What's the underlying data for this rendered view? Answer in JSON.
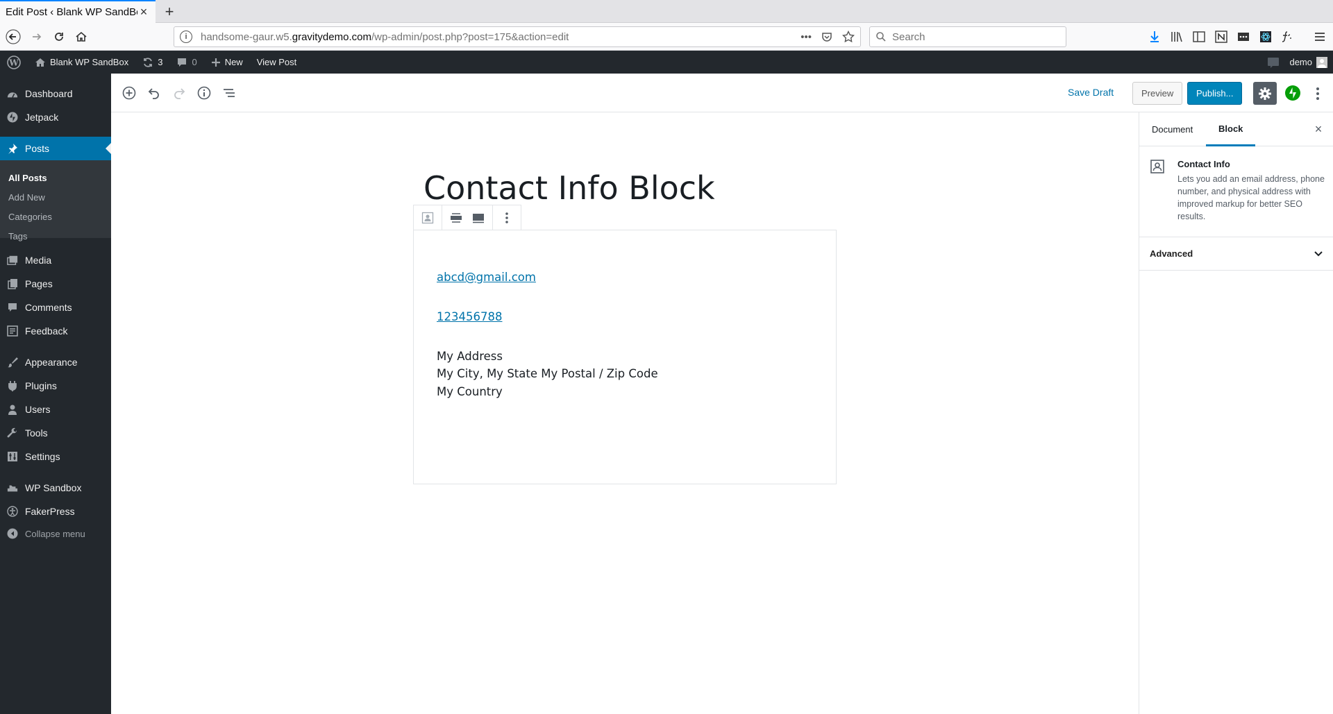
{
  "browser": {
    "tab_title": "Edit Post ‹ Blank WP SandBox",
    "tab_close": "×",
    "new_tab": "+",
    "url_prefix": "handsome-gaur.w5.",
    "url_host": "gravitydemo.com",
    "url_path": "/wp-admin/post.php?post=175&action=edit",
    "url_more": "•••",
    "search_placeholder": "Search"
  },
  "adminbar": {
    "site_name": "Blank WP SandBox",
    "updates_count": "3",
    "comments_count": "0",
    "new_label": "New",
    "view_post_label": "View Post",
    "user_name": "demo"
  },
  "sidebar": {
    "dashboard": "Dashboard",
    "jetpack": "Jetpack",
    "posts": "Posts",
    "all_posts": "All Posts",
    "add_new": "Add New",
    "categories": "Categories",
    "tags": "Tags",
    "media": "Media",
    "pages": "Pages",
    "comments": "Comments",
    "feedback": "Feedback",
    "appearance": "Appearance",
    "plugins": "Plugins",
    "users": "Users",
    "tools": "Tools",
    "settings": "Settings",
    "wp_sandbox": "WP Sandbox",
    "fakerpress": "FakerPress",
    "collapse": "Collapse menu"
  },
  "editor": {
    "save_draft": "Save Draft",
    "preview": "Preview",
    "publish": "Publish...",
    "post_title": "Contact Info Block",
    "email": "abcd@gmail.com",
    "phone": "123456788",
    "address_line1": "My Address",
    "address_line2": "My City, My State My Postal / Zip Code",
    "address_line3": "My Country"
  },
  "settings_panel": {
    "tab_document": "Document",
    "tab_block": "Block",
    "close": "×",
    "block_title": "Contact Info",
    "block_description": "Lets you add an email address, phone number, and physical address with improved markup for better SEO results.",
    "advanced": "Advanced"
  },
  "colors": {
    "admin_dark": "#23282d",
    "accent_blue": "#0073aa",
    "publish_blue": "#0085ba",
    "jetpack_green": "#069e08"
  }
}
